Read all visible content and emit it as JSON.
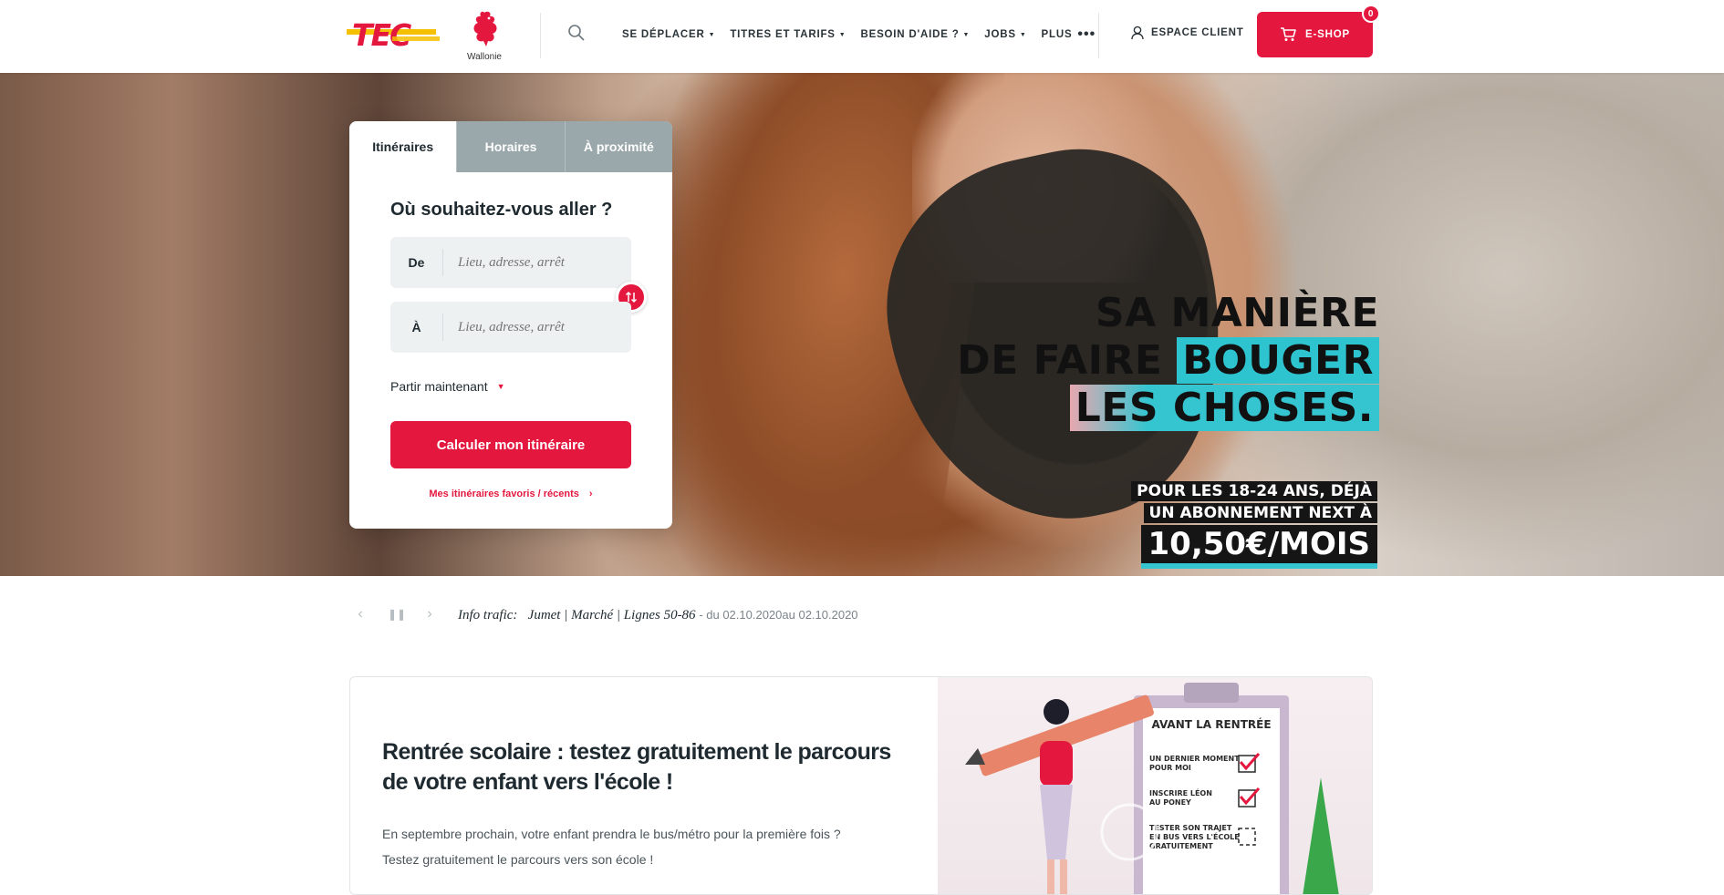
{
  "header": {
    "logo_text": "TEC",
    "region_label": "Wallonie",
    "nav": [
      {
        "label": "SE DÉPLACER"
      },
      {
        "label": "TITRES ET TARIFS"
      },
      {
        "label": "BESOIN D'AIDE ?"
      },
      {
        "label": "JOBS"
      },
      {
        "label": "PLUS"
      }
    ],
    "more_dots": "•••",
    "espace_client": "ESPACE CLIENT",
    "eshop": "E-SHOP",
    "cart_count": "0"
  },
  "hero": {
    "slogan": {
      "line1": "SA MANIÈRE",
      "line2a": "DE FAIRE ",
      "line2b": "BOUGER",
      "line3": "LES CHOSES."
    },
    "promo": {
      "line1": "POUR LES 18-24 ANS, DÉJÀ",
      "line2": "UN ABONNEMENT NEXT À",
      "price": "10,50€/MOIS"
    }
  },
  "planner": {
    "tabs": [
      {
        "label": "Itinéraires",
        "active": true
      },
      {
        "label": "Horaires",
        "active": false
      },
      {
        "label": "À proximité",
        "active": false
      }
    ],
    "title": "Où souhaitez-vous aller ?",
    "from_label": "De",
    "to_label": "À",
    "placeholder": "Lieu, adresse, arrêt",
    "depart": "Partir maintenant",
    "submit": "Calculer mon itinéraire",
    "favorites": "Mes itinéraires favoris / récents"
  },
  "traffic": {
    "label": "Info trafic:",
    "message": "Jumet | Marché | Lignes 50-86",
    "dates": "- du 02.10.2020au 02.10.2020"
  },
  "news": {
    "title": "Rentrée scolaire : testez gratuitement le parcours de votre enfant vers l'école !",
    "text_line1": "En septembre prochain, votre enfant prendra le bus/métro pour la première fois ?",
    "text_line2": "Testez gratuitement le parcours vers son école !",
    "illustration": {
      "heading": "AVANT LA RENTRÉE",
      "item1a": "UN DERNIER MOMENT",
      "item1b": "POUR MOI",
      "item2a": "INSCRIRE LÉON",
      "item2b": "AU PONEY",
      "item3a": "TESTER SON TRAJET",
      "item3b": "EN BUS VERS L'ÉCOLE",
      "item3c": "GRATUITEMENT"
    }
  },
  "colors": {
    "brand_red": "#e4173e",
    "tec_yellow": "#f5c000",
    "tab_inactive": "#9aa8ab",
    "slogan_highlight": "#35c5d0"
  }
}
